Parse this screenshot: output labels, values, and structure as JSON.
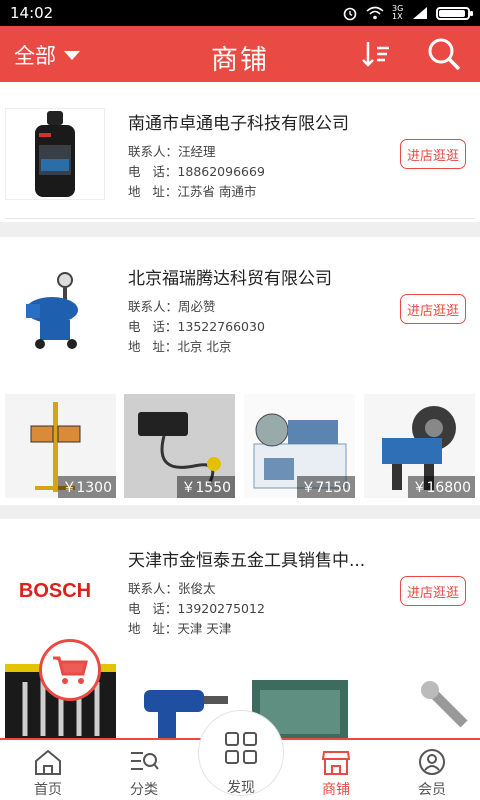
{
  "status_bar": {
    "time": "14:02",
    "network": "3G 1X"
  },
  "header": {
    "filter_label": "全部",
    "title": "商铺"
  },
  "stores": [
    {
      "name": "南通市卓通电子科技有限公司",
      "contact_label": "联系人：",
      "contact": "汪经理",
      "phone_label": "电   话：",
      "phone": "18862096669",
      "address_label": "地   址：",
      "address": "江苏省 南通市",
      "button": "进店逛逛"
    },
    {
      "name": "北京福瑞腾达科贸有限公司",
      "contact_label": "联系人：",
      "contact": "周必赞",
      "phone_label": "电   话：",
      "phone": "13522766030",
      "address_label": "地   址：",
      "address": "北京 北京",
      "button": "进店逛逛",
      "products": [
        {
          "price": "￥1300"
        },
        {
          "price": "￥1550"
        },
        {
          "price": "￥7150"
        },
        {
          "price": "￥16800"
        }
      ]
    },
    {
      "name": "天津市金恒泰五金工具销售中...",
      "contact_label": "联系人：",
      "contact": "张俊太",
      "phone_label": "电   话：",
      "phone": "13920275012",
      "address_label": "地   址：",
      "address": "天津 天津",
      "button": "进店逛逛",
      "logo_text": "BOSCH"
    }
  ],
  "tabbar": {
    "items": [
      {
        "label": "首页",
        "icon": "home-icon"
      },
      {
        "label": "分类",
        "icon": "category-icon"
      },
      {
        "label": "发现",
        "icon": "grid-icon"
      },
      {
        "label": "商铺",
        "icon": "shop-icon"
      },
      {
        "label": "会员",
        "icon": "user-icon"
      }
    ],
    "active": "商铺"
  },
  "colors": {
    "accent": "#e94b44",
    "background": "#efefef"
  }
}
